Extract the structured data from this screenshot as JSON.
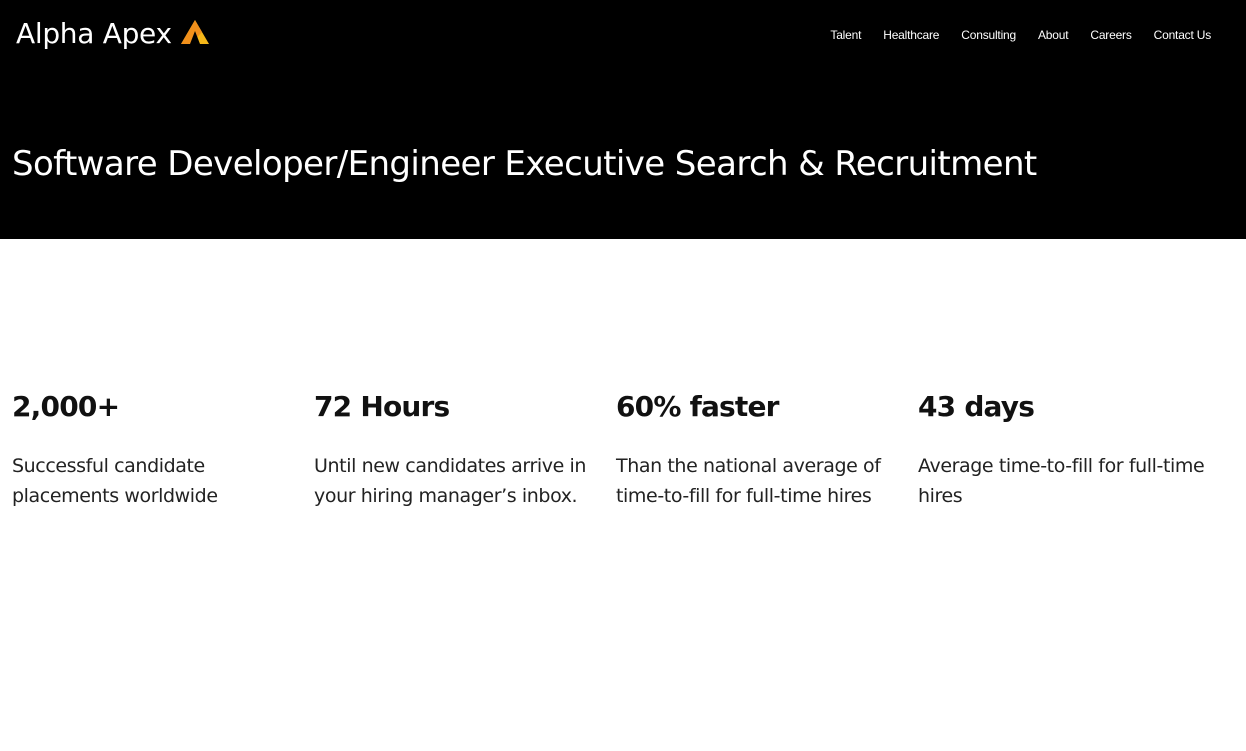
{
  "header": {
    "logo_text": "Alpha Apex",
    "logo_icon": "apex-triangle-icon",
    "nav": [
      {
        "label": "Talent"
      },
      {
        "label": "Healthcare"
      },
      {
        "label": "Consulting"
      },
      {
        "label": "About"
      },
      {
        "label": "Careers"
      },
      {
        "label": "Contact Us"
      }
    ]
  },
  "hero": {
    "title": "Software Developer/Engineer Executive Search & Recruitment"
  },
  "stats": [
    {
      "value": "2,000+",
      "description": "Successful candidate placements worldwide"
    },
    {
      "value": "72 Hours",
      "description": "Until new candidates arrive in your hiring manager’s inbox."
    },
    {
      "value": "60% faster",
      "description": "Than the national average of time-to-fill for full-time hires"
    },
    {
      "value": "43 days",
      "description": "Average time-to-fill for full-time hires"
    }
  ],
  "colors": {
    "hero_background": "#000000",
    "logo_accent_yellow": "#F5B719",
    "logo_accent_orange": "#F08A1C",
    "page_background": "#FFFFFF"
  }
}
